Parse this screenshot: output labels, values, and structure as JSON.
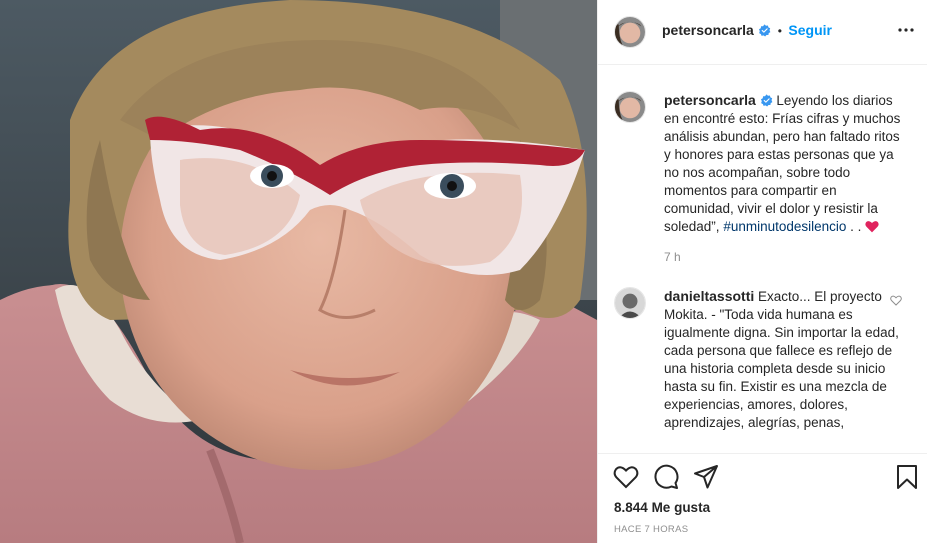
{
  "post": {
    "author": "petersoncarla",
    "follow_label": "Seguir",
    "dot": "•",
    "caption_author": "petersoncarla",
    "caption_text": "Leyendo los diarios en encontré esto: Frías cifras y muchos análisis abundan, pero han faltado ritos y honores para estas personas que ya no nos acompañan, sobre todo momentos para compartir en comunidad, vivir el dolor y resistir la soledad”,",
    "caption_hashtag": "#unminutodesilencio",
    "caption_tail": " . .",
    "caption_time": "7 h"
  },
  "comment": {
    "author": "danieltassotti",
    "text": "Exacto... El proyecto Mokita. - \"Toda vida humana es igualmente digna. Sin importar la edad, cada persona que fallece es reflejo de una historia completa desde su inicio hasta su fin. Existir es una mezcla de experiencias, amores, dolores, aprendizajes, alegrías, penas,"
  },
  "footer": {
    "likes_count": "8.844",
    "likes_label": "Me gusta",
    "time_ago": "HACE 7 HORAS"
  },
  "icons": {
    "like": "heart-outline-icon",
    "comment": "comment-bubble-icon",
    "share": "paper-plane-icon",
    "save": "bookmark-icon",
    "more": "more-dots-icon",
    "verified": "verified-badge-icon",
    "comment_like": "small-heart-icon"
  },
  "colors": {
    "accent": "#0095f6",
    "verified": "#3897f0",
    "heart_emoji": "#e0245e",
    "hashtag": "#00376b"
  }
}
